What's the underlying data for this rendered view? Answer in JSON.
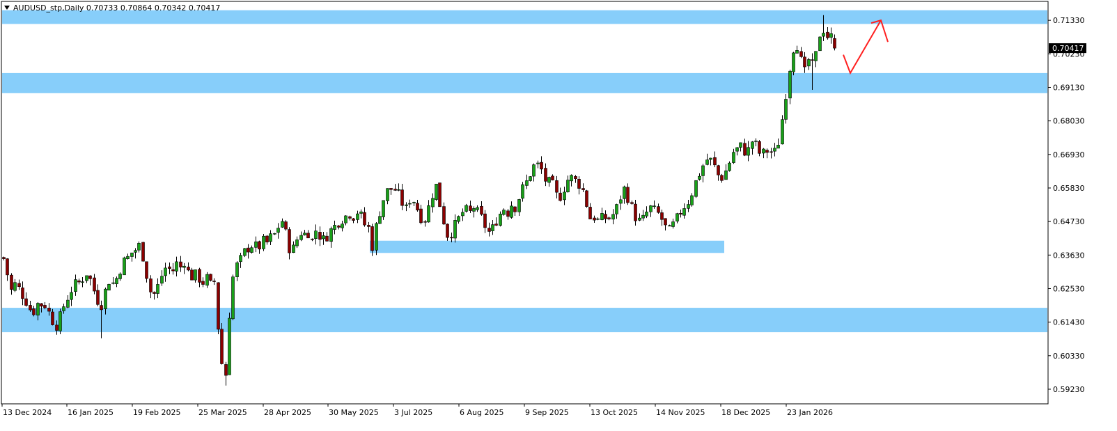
{
  "header": {
    "symbol_line": "AUDUSD_stp,Daily  0.70733 0.70864 0.70342 0.70417",
    "menu_icon": "triangle-down-icon"
  },
  "chart_data": {
    "type": "candlestick",
    "symbol": "AUDUSD_stp",
    "timeframe": "Daily",
    "ohlc_current": {
      "open": 0.70733,
      "high": 0.70864,
      "low": 0.70342,
      "close": 0.70417
    },
    "price_badge": "0.70417",
    "ylim": [
      0.5875,
      0.7195
    ],
    "y_ticks": [
      "0.71330",
      "0.70230",
      "0.69130",
      "0.68030",
      "0.66930",
      "0.65830",
      "0.64730",
      "0.63630",
      "0.62530",
      "0.61430",
      "0.60330",
      "0.59230"
    ],
    "x_ticks": [
      "13 Dec 2024",
      "16 Jan 2025",
      "19 Feb 2025",
      "25 Mar 2025",
      "28 Apr 2025",
      "30 May 2025",
      "3 Jul 2025",
      "6 Aug 2025",
      "9 Sep 2025",
      "13 Oct 2025",
      "14 Nov 2025",
      "18 Dec 2025",
      "23 Jan 2026"
    ],
    "close_path": [
      [
        0,
        0.637
      ],
      [
        8,
        0.634
      ],
      [
        14,
        0.624
      ],
      [
        22,
        0.627
      ],
      [
        30,
        0.624
      ],
      [
        38,
        0.621
      ],
      [
        46,
        0.617
      ],
      [
        54,
        0.6205
      ],
      [
        60,
        0.62
      ],
      [
        66,
        0.62
      ],
      [
        72,
        0.616
      ],
      [
        80,
        0.613
      ],
      [
        86,
        0.616
      ],
      [
        92,
        0.62
      ],
      [
        100,
        0.624
      ],
      [
        106,
        0.6265
      ],
      [
        112,
        0.627
      ],
      [
        118,
        0.6285
      ],
      [
        124,
        0.6305
      ],
      [
        128,
        0.629
      ],
      [
        134,
        0.625
      ],
      [
        140,
        0.6215
      ],
      [
        144,
        0.619
      ],
      [
        150,
        0.624
      ],
      [
        156,
        0.628
      ],
      [
        162,
        0.627
      ],
      [
        168,
        0.629
      ],
      [
        176,
        0.634
      ],
      [
        182,
        0.635
      ],
      [
        188,
        0.637
      ],
      [
        194,
        0.638
      ],
      [
        200,
        0.6395
      ],
      [
        206,
        0.635
      ],
      [
        210,
        0.63
      ],
      [
        216,
        0.624
      ],
      [
        222,
        0.6235
      ],
      [
        228,
        0.627
      ],
      [
        234,
        0.631
      ],
      [
        240,
        0.633
      ],
      [
        246,
        0.63
      ],
      [
        252,
        0.634
      ],
      [
        258,
        0.632
      ],
      [
        264,
        0.6345
      ],
      [
        270,
        0.6305
      ],
      [
        276,
        0.629
      ],
      [
        282,
        0.63
      ],
      [
        290,
        0.627
      ],
      [
        296,
        0.629
      ],
      [
        300,
        0.627
      ],
      [
        304,
        0.626
      ],
      [
        308,
        0.628
      ],
      [
        312,
        0.615
      ],
      [
        316,
        0.603
      ],
      [
        320,
        0.599
      ],
      [
        324,
        0.597
      ],
      [
        328,
        0.614
      ],
      [
        332,
        0.626
      ],
      [
        336,
        0.631
      ],
      [
        340,
        0.633
      ],
      [
        346,
        0.635
      ],
      [
        352,
        0.638
      ],
      [
        358,
        0.639
      ],
      [
        364,
        0.64
      ],
      [
        370,
        0.638
      ],
      [
        376,
        0.641
      ],
      [
        382,
        0.64
      ],
      [
        388,
        0.642
      ],
      [
        394,
        0.643
      ],
      [
        400,
        0.646
      ],
      [
        406,
        0.648
      ],
      [
        412,
        0.641
      ],
      [
        418,
        0.637
      ],
      [
        424,
        0.64
      ],
      [
        430,
        0.644
      ],
      [
        436,
        0.643
      ],
      [
        442,
        0.644
      ],
      [
        448,
        0.641
      ],
      [
        454,
        0.645
      ],
      [
        460,
        0.642
      ],
      [
        466,
        0.641
      ],
      [
        472,
        0.644
      ],
      [
        478,
        0.645
      ],
      [
        484,
        0.647
      ],
      [
        490,
        0.648
      ],
      [
        496,
        0.649
      ],
      [
        502,
        0.65
      ],
      [
        508,
        0.649
      ],
      [
        514,
        0.651
      ],
      [
        518,
        0.649
      ],
      [
        524,
        0.646
      ],
      [
        530,
        0.645
      ],
      [
        534,
        0.639
      ],
      [
        538,
        0.644
      ],
      [
        542,
        0.648
      ],
      [
        548,
        0.653
      ],
      [
        554,
        0.657
      ],
      [
        560,
        0.658
      ],
      [
        566,
        0.658
      ],
      [
        572,
        0.656
      ],
      [
        578,
        0.653
      ],
      [
        584,
        0.651
      ],
      [
        590,
        0.656
      ],
      [
        596,
        0.653
      ],
      [
        602,
        0.65
      ],
      [
        608,
        0.647
      ],
      [
        614,
        0.651
      ],
      [
        620,
        0.656
      ],
      [
        626,
        0.659
      ],
      [
        630,
        0.654
      ],
      [
        634,
        0.651
      ],
      [
        638,
        0.646
      ],
      [
        642,
        0.643
      ],
      [
        646,
        0.643
      ],
      [
        650,
        0.645
      ],
      [
        656,
        0.647
      ],
      [
        662,
        0.65
      ],
      [
        668,
        0.651
      ],
      [
        674,
        0.65
      ],
      [
        680,
        0.652
      ],
      [
        686,
        0.65
      ],
      [
        692,
        0.648
      ],
      [
        698,
        0.645
      ],
      [
        704,
        0.643
      ],
      [
        710,
        0.647
      ],
      [
        716,
        0.649
      ],
      [
        722,
        0.652
      ],
      [
        728,
        0.65
      ],
      [
        734,
        0.653
      ],
      [
        740,
        0.652
      ],
      [
        746,
        0.656
      ],
      [
        752,
        0.659
      ],
      [
        758,
        0.661
      ],
      [
        764,
        0.665
      ],
      [
        770,
        0.666
      ],
      [
        776,
        0.665
      ],
      [
        782,
        0.661
      ],
      [
        788,
        0.66
      ],
      [
        794,
        0.659
      ],
      [
        800,
        0.655
      ],
      [
        806,
        0.656
      ],
      [
        812,
        0.66
      ],
      [
        818,
        0.662
      ],
      [
        824,
        0.661
      ],
      [
        830,
        0.66
      ],
      [
        836,
        0.658
      ],
      [
        842,
        0.653
      ],
      [
        848,
        0.648
      ],
      [
        854,
        0.649
      ],
      [
        860,
        0.647
      ],
      [
        866,
        0.649
      ],
      [
        872,
        0.648
      ],
      [
        878,
        0.649
      ],
      [
        884,
        0.651
      ],
      [
        890,
        0.655
      ],
      [
        896,
        0.658
      ],
      [
        902,
        0.655
      ],
      [
        908,
        0.651
      ],
      [
        914,
        0.648
      ],
      [
        920,
        0.647
      ],
      [
        926,
        0.649
      ],
      [
        932,
        0.652
      ],
      [
        938,
        0.651
      ],
      [
        944,
        0.65
      ],
      [
        950,
        0.648
      ],
      [
        956,
        0.645
      ],
      [
        962,
        0.644
      ],
      [
        968,
        0.647
      ],
      [
        974,
        0.649
      ],
      [
        980,
        0.652
      ],
      [
        986,
        0.653
      ],
      [
        992,
        0.656
      ],
      [
        998,
        0.66
      ],
      [
        1004,
        0.663
      ],
      [
        1010,
        0.666
      ],
      [
        1016,
        0.668
      ],
      [
        1022,
        0.667
      ],
      [
        1028,
        0.664
      ],
      [
        1034,
        0.661
      ],
      [
        1040,
        0.663
      ],
      [
        1046,
        0.666
      ],
      [
        1052,
        0.67
      ],
      [
        1058,
        0.671
      ],
      [
        1064,
        0.672
      ],
      [
        1070,
        0.67
      ],
      [
        1076,
        0.671
      ],
      [
        1080,
        0.674
      ],
      [
        1086,
        0.672
      ],
      [
        1092,
        0.669
      ],
      [
        1098,
        0.67
      ],
      [
        1104,
        0.671
      ],
      [
        1110,
        0.669
      ],
      [
        1116,
        0.672
      ],
      [
        1120,
        0.676
      ],
      [
        1124,
        0.683
      ],
      [
        1128,
        0.689
      ],
      [
        1132,
        0.695
      ],
      [
        1136,
        0.702
      ],
      [
        1140,
        0.705
      ],
      [
        1144,
        0.706
      ],
      [
        1148,
        0.699
      ],
      [
        1152,
        0.701
      ],
      [
        1156,
        0.695
      ],
      [
        1160,
        0.7
      ],
      [
        1164,
        0.702
      ],
      [
        1168,
        0.695
      ],
      [
        1172,
        0.703
      ],
      [
        1176,
        0.708
      ],
      [
        1180,
        0.712
      ],
      [
        1184,
        0.709
      ],
      [
        1188,
        0.708
      ],
      [
        1192,
        0.708
      ],
      [
        1196,
        0.707
      ],
      [
        1200,
        0.7042
      ]
    ],
    "zones": [
      {
        "type": "resistance",
        "from": 0.7121,
        "to": 0.7166,
        "x_end": "edge"
      },
      {
        "type": "support",
        "from": 0.6894,
        "to": 0.696,
        "x_end": "edge"
      },
      {
        "type": "support",
        "from": 0.637,
        "to": 0.641,
        "x_start": 531,
        "x_end": 1040
      },
      {
        "type": "support",
        "from": 0.611,
        "to": 0.619,
        "x_end": "edge"
      }
    ],
    "projection": {
      "color": "#ff2020",
      "points": [
        [
          1211,
          0.702
        ],
        [
          1221,
          0.696
        ],
        [
          1265,
          0.7133
        ]
      ],
      "arrow_head": true
    },
    "zone_color": "#87cefa",
    "bull_color": "#18a018",
    "bear_color": "#8b0000",
    "grid": false,
    "legend": "none"
  }
}
